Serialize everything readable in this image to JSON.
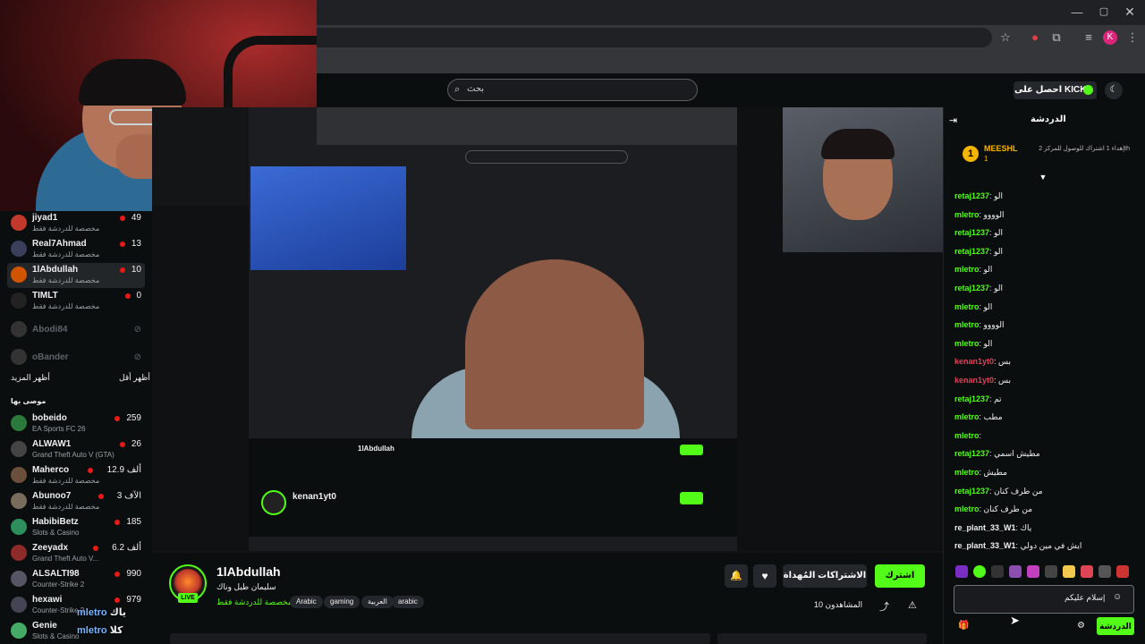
{
  "browser": {
    "win_min": "—",
    "win_max": "▢",
    "win_close": "✕",
    "profile_initial": "K"
  },
  "header": {
    "search_placeholder": "بحث",
    "get_kicks": "احصل على KICKs"
  },
  "left_sidebar": {
    "followed": [
      {
        "name": "jiyad1",
        "game": "مخصصة للدردشة فقط",
        "viewers": "49",
        "live": true,
        "avatar_color": "#c0392b"
      },
      {
        "name": "Real7Ahmad",
        "game": "مخصصة للدردشة فقط",
        "viewers": "13",
        "live": true,
        "avatar_color": "#3a3f5c"
      },
      {
        "name": "1lAbdullah",
        "game": "مخصصة للدردشة فقط",
        "viewers": "10",
        "live": true,
        "avatar_color": "#d35400",
        "active": true
      },
      {
        "name": "TIMLT",
        "game": "مخصصة للدردشة فقط",
        "viewers": "0",
        "live": true,
        "avatar_color": "#222"
      },
      {
        "name": "Abodi84",
        "game": "",
        "viewers": "",
        "live": false,
        "avatar_color": "#333"
      },
      {
        "name": "oBander",
        "game": "",
        "viewers": "",
        "live": false,
        "avatar_color": "#333"
      }
    ],
    "show_more": "أظهر المزيد",
    "show_less": "أظهر أقل",
    "recommended_header": "موصى بها",
    "recommended": [
      {
        "name": "bobeido",
        "game": "EA Sports FC 26",
        "viewers": "259",
        "avatar_color": "#2c7a3b"
      },
      {
        "name": "ALWAW1",
        "game": "Grand Theft Auto V (GTA)",
        "viewers": "26",
        "avatar_color": "#444"
      },
      {
        "name": "Maherco",
        "game": "مخصصة للدردشة فقط",
        "viewers": "12.9 ألف",
        "avatar_color": "#6b4f3a"
      },
      {
        "name": "Abunoo7",
        "game": "مخصصة للدردشة فقط",
        "viewers": "3 الآف",
        "avatar_color": "#7a6c5d"
      },
      {
        "name": "HabibiBetz",
        "game": "Slots & Casino",
        "viewers": "185",
        "avatar_color": "#2d8f5b"
      },
      {
        "name": "Zeeyadx",
        "game": "Grand Theft Auto V...",
        "viewers": "6.2 ألف",
        "avatar_color": "#8e2a2a"
      },
      {
        "name": "ALSALTI98",
        "game": "Counter-Strike 2",
        "viewers": "990",
        "avatar_color": "#556"
      },
      {
        "name": "hexawi",
        "game": "Counter-Strike 2",
        "viewers": "979",
        "avatar_color": "#445"
      },
      {
        "name": "Genie",
        "game": "Slots & Casino",
        "viewers": "",
        "avatar_color": "#4a6"
      }
    ]
  },
  "overlay_chat": [
    {
      "user": "mletro",
      "text": "ياك"
    },
    {
      "user": "mletro",
      "text": "كلا"
    }
  ],
  "nested": {
    "title": "1lAbdullah",
    "streamer2": "kenan1yt0"
  },
  "stream": {
    "name": "1lAbdullah",
    "title": "سليمان طيل وناك",
    "category": "مخصصة للدردشة فقط",
    "tags": [
      "Arabic",
      "gaming",
      "العربية",
      "arabic"
    ],
    "subscribe": "اشترك",
    "gift": "الاشتراكات المُهداة",
    "viewers_label": "المشاهدون 10"
  },
  "chat": {
    "title": "الدردشة",
    "pinned": {
      "rank": "1",
      "user": "MEESHL",
      "value": "1",
      "text": "إهداء 1 اشتراك للوصول للمركز 2th"
    },
    "messages": [
      {
        "user": "retaj1237",
        "color": "#53fc18",
        "text": "الو"
      },
      {
        "user": "mletro",
        "color": "#53fc18",
        "text": "الوووو"
      },
      {
        "user": "retaj1237",
        "color": "#53fc18",
        "text": "الو"
      },
      {
        "user": "retaj1237",
        "color": "#53fc18",
        "text": "الو"
      },
      {
        "user": "mletro",
        "color": "#53fc18",
        "text": "الو"
      },
      {
        "user": "retaj1237",
        "color": "#53fc18",
        "text": "الو"
      },
      {
        "user": "mletro",
        "color": "#53fc18",
        "text": "الو"
      },
      {
        "user": "mletro",
        "color": "#53fc18",
        "text": "الوووو"
      },
      {
        "user": "mletro",
        "color": "#53fc18",
        "text": "الو"
      },
      {
        "user": "kenan1yt0",
        "color": "#e0405a",
        "text": "بس"
      },
      {
        "user": "kenan1yt0",
        "color": "#e0405a",
        "text": "بس"
      },
      {
        "user": "retaj1237",
        "color": "#53fc18",
        "text": "تم"
      },
      {
        "user": "mletro",
        "color": "#53fc18",
        "text": "مطب"
      },
      {
        "user": "mletro",
        "color": "#53fc18",
        "text": ""
      },
      {
        "user": "retaj1237",
        "color": "#53fc18",
        "text": "مطيش اسمي"
      },
      {
        "user": "mletro",
        "color": "#53fc18",
        "text": "مطيش"
      },
      {
        "user": "retaj1237",
        "color": "#53fc18",
        "text": "من طرف كنان"
      },
      {
        "user": "mletro",
        "color": "#53fc18",
        "text": "من طرف كنان"
      },
      {
        "user": "re_plant_33_W1",
        "color": "#efeff1",
        "text": "ياك"
      },
      {
        "user": "re_plant_33_W1",
        "color": "#efeff1",
        "text": "ايش في مين دولي"
      }
    ],
    "input_value": "سلام عليكم|",
    "send_label": "الدردشة"
  }
}
